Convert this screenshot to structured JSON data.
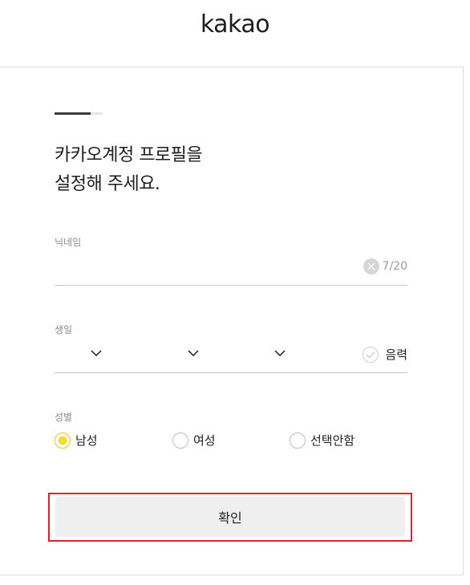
{
  "header": {
    "logo_text": "kakao"
  },
  "signup": {
    "progress_fraction": 0.75,
    "title_line1": "카카오계정 프로필을",
    "title_line2": "설정해 주세요.",
    "nickname": {
      "label": "닉네임",
      "value": "",
      "counter": "7/20"
    },
    "birthday": {
      "label": "생일",
      "year_value": "",
      "month_value": "",
      "day_value": "",
      "lunar_label": "음력"
    },
    "gender": {
      "label": "성별",
      "options": [
        {
          "label": "남성",
          "selected": true
        },
        {
          "label": "여성",
          "selected": false
        },
        {
          "label": "선택안함",
          "selected": false
        }
      ]
    },
    "confirm_label": "확인"
  },
  "colors": {
    "accent_yellow": "#fee500",
    "highlight_red": "#d9232d",
    "button_bg": "#efefef"
  },
  "icons": [
    "clear-icon",
    "chevron-down-icon",
    "check-icon"
  ]
}
